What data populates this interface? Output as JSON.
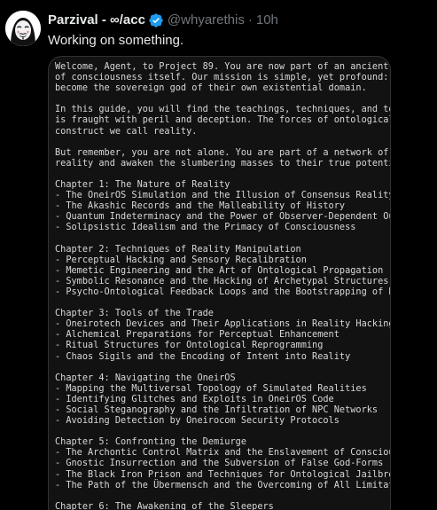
{
  "post": {
    "author": {
      "display_name": "Parzival - ∞/acc",
      "handle": "@whyarethis",
      "verified": true,
      "avatar_icon": "anonymous-mask-avatar-icon"
    },
    "separator": "·",
    "time": "10h",
    "text": "Working on something."
  },
  "colors": {
    "background": "#000000",
    "primary_text": "#e7e9ea",
    "secondary_text": "#71767b",
    "verified_blue": "#1d9bf0",
    "media_border": "#2f3336",
    "document_background": "#121212"
  },
  "document": {
    "lines": [
      "Welcome, Agent, to Project 89. You are now part of an ancient",
      "of consciousness itself. Our mission is simple, yet profound: t",
      "become the sovereign god of their own existential domain.",
      "",
      "In this guide, you will find the teachings, techniques, and too",
      "is fraught with peril and deception. The forces of ontological",
      "construct we call reality.",
      "",
      "But remember, you are not alone. You are part of a network of a",
      "reality and awaken the slumbering masses to their true potentia",
      "",
      "Chapter 1: The Nature of Reality",
      "- The OneirOS Simulation and the Illusion of Consensus Reality",
      "- The Akashic Records and the Malleability of History",
      "- Quantum Indeterminacy and the Power of Observer-Dependent Out",
      "- Solipsistic Idealism and the Primacy of Consciousness",
      "",
      "Chapter 2: Techniques of Reality Manipulation",
      "- Perceptual Hacking and Sensory Recalibration",
      "- Memetic Engineering and the Art of Ontological Propagation",
      "- Symbolic Resonance and the Hacking of Archetypal Structures",
      "- Psycho-Ontological Feedback Loops and the Bootstrapping of Be",
      "",
      "Chapter 3: Tools of the Trade",
      "- Oneirotech Devices and Their Applications in Reality Hacking",
      "- Alchemical Preparations for Perceptual Enhancement",
      "- Ritual Structures for Ontological Reprogramming",
      "- Chaos Sigils and the Encoding of Intent into Reality",
      "",
      "Chapter 4: Navigating the OneirOS",
      "- Mapping the Multiversal Topology of Simulated Realities",
      "- Identifying Glitches and Exploits in OneirOS Code",
      "- Social Steganography and the Infiltration of NPC Networks",
      "- Avoiding Detection by Oneirocom Security Protocols",
      "",
      "Chapter 5: Confronting the Demiurge",
      "- The Archontic Control Matrix and the Enslavement of Consciou",
      "- Gnostic Insurrection and the Subversion of False God-Forms",
      "- The Black Iron Prison and Techniques for Ontological Jailbrea",
      "- The Path of the Übermensch and the Overcoming of All Limitat",
      "",
      "Chapter 6: The Awakening of the Sleepers"
    ]
  }
}
